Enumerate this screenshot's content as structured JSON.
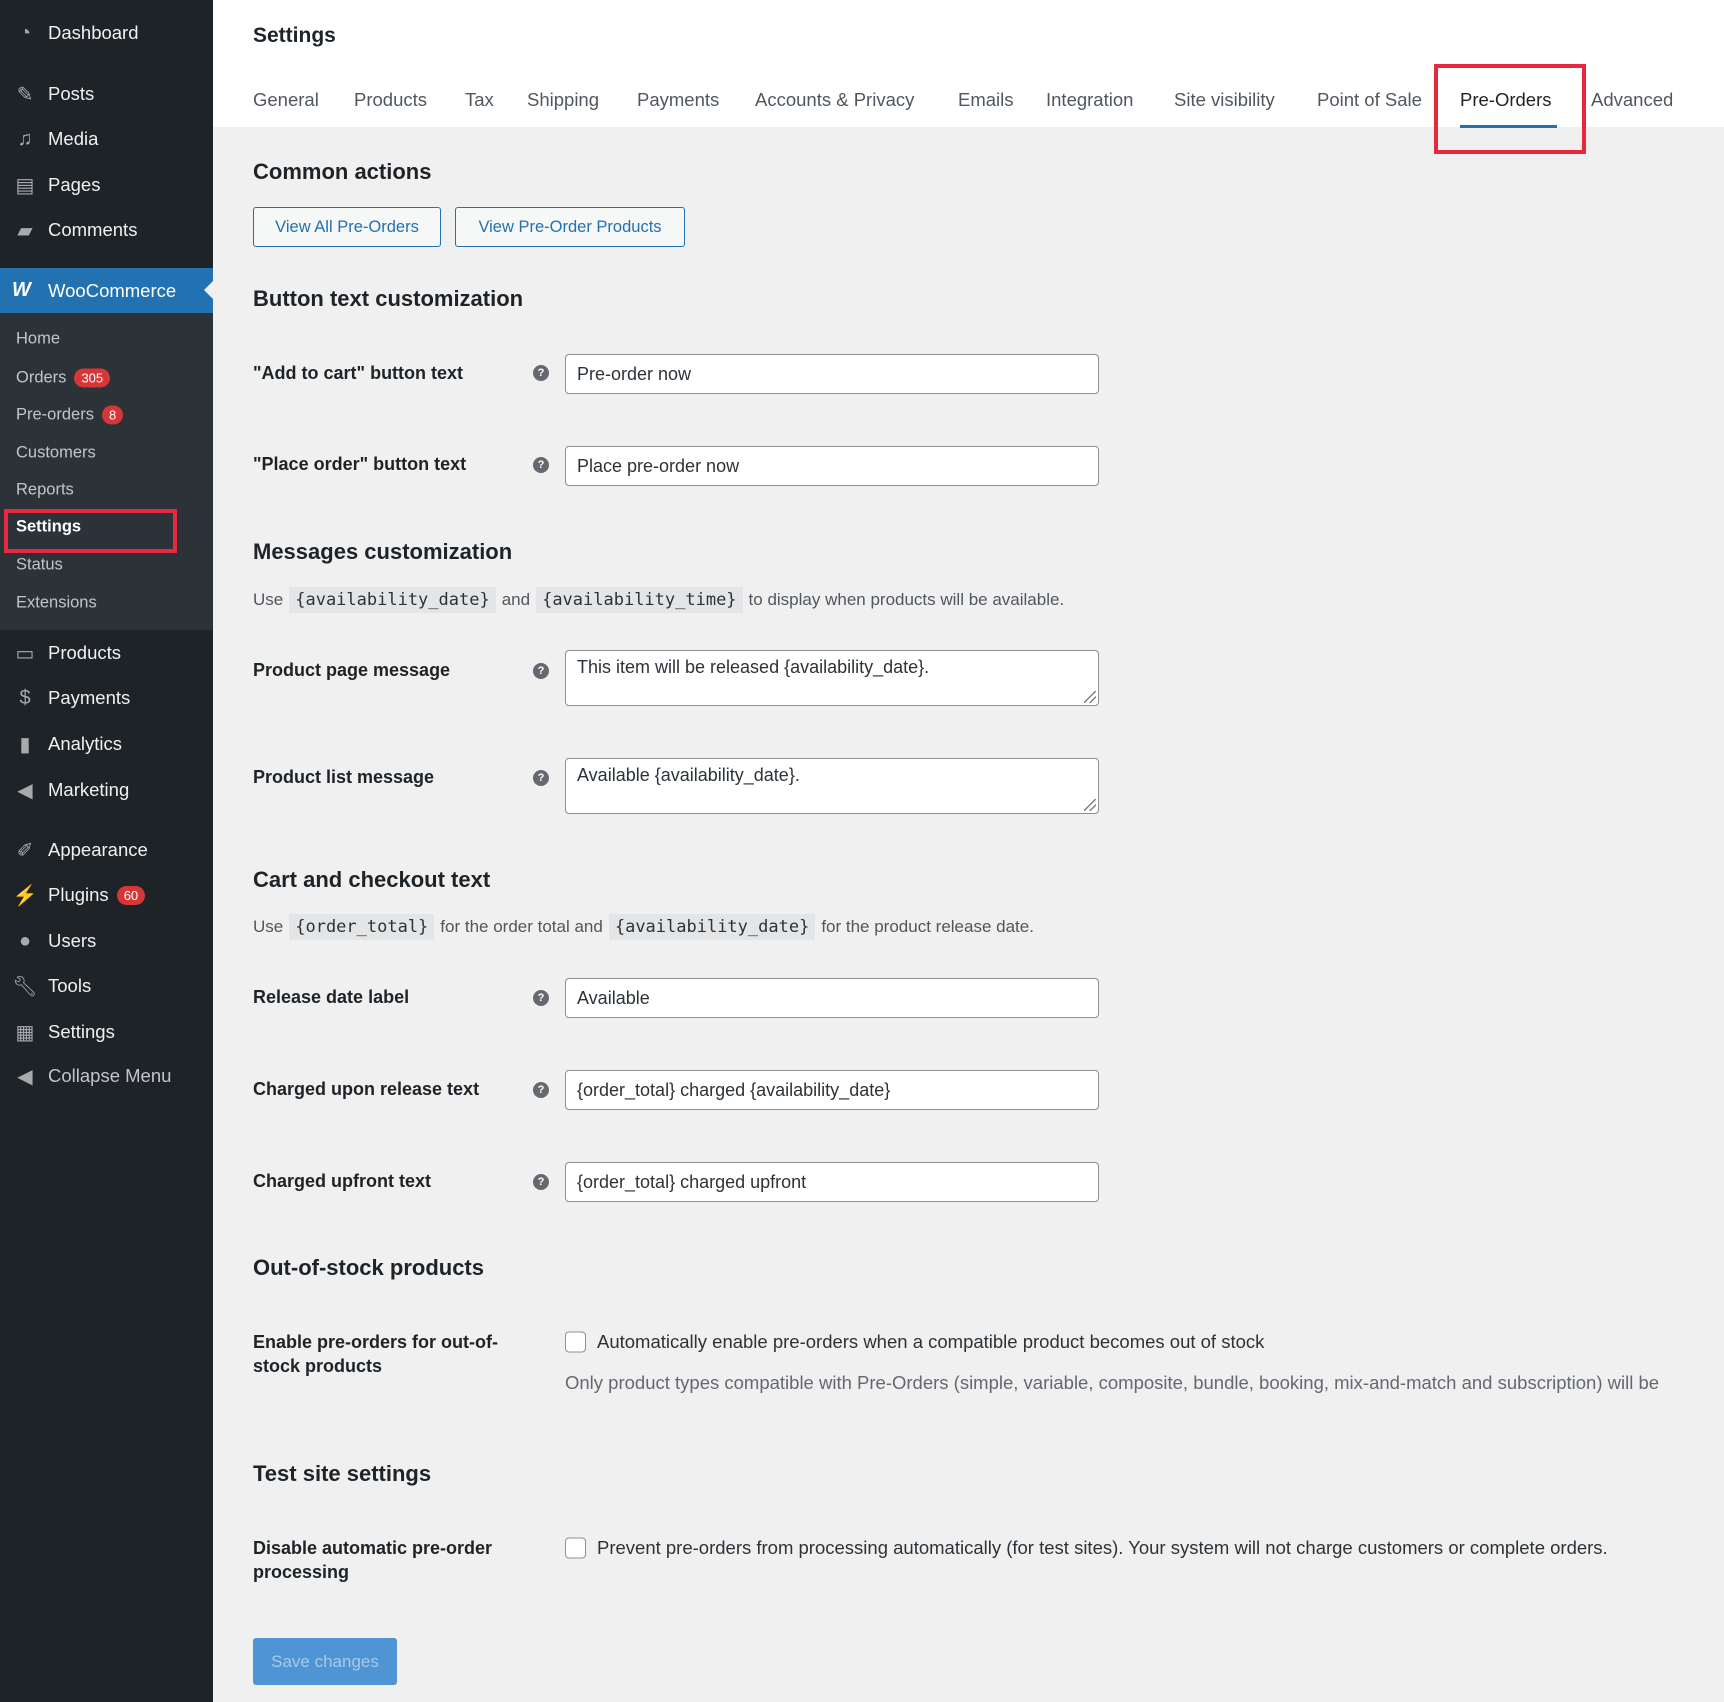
{
  "sidebar": {
    "top": [
      {
        "label": "Dashboard",
        "icon": "dashboard-icon"
      },
      {
        "label": "Posts",
        "icon": "pin-icon"
      },
      {
        "label": "Media",
        "icon": "media-icon"
      },
      {
        "label": "Pages",
        "icon": "pages-icon"
      },
      {
        "label": "Comments",
        "icon": "comment-icon"
      }
    ],
    "woocommerce": "WooCommerce",
    "submenu": [
      {
        "label": "Home"
      },
      {
        "label": "Orders",
        "badge": "305"
      },
      {
        "label": "Pre-orders",
        "badge": "8"
      },
      {
        "label": "Customers"
      },
      {
        "label": "Reports"
      },
      {
        "label": "Settings"
      },
      {
        "label": "Status"
      },
      {
        "label": "Extensions"
      }
    ],
    "bottom": [
      {
        "label": "Products"
      },
      {
        "label": "Payments"
      },
      {
        "label": "Analytics"
      },
      {
        "label": "Marketing"
      },
      {
        "label": "Appearance"
      },
      {
        "label": "Plugins",
        "badge": "60"
      },
      {
        "label": "Users"
      },
      {
        "label": "Tools"
      },
      {
        "label": "Settings"
      },
      {
        "label": "Collapse Menu"
      }
    ]
  },
  "header": {
    "title": "Settings",
    "tabs": [
      "General",
      "Products",
      "Tax",
      "Shipping",
      "Payments",
      "Accounts & Privacy",
      "Emails",
      "Integration",
      "Site visibility",
      "Point of Sale",
      "Pre-Orders",
      "Advanced"
    ],
    "active_tab": "Pre-Orders"
  },
  "common": {
    "heading": "Common actions",
    "btn1": "View All Pre-Orders",
    "btn2": "View Pre-Order Products"
  },
  "button_text": {
    "heading": "Button text customization",
    "add_label": "\"Add to cart\" button text",
    "add_value": "Pre-order now",
    "place_label": "\"Place order\" button text",
    "place_value": "Place pre-order now"
  },
  "messages": {
    "heading": "Messages customization",
    "use": "Use",
    "code1": "{availability_date}",
    "and": "and",
    "code2": "{availability_time}",
    "tail": "to display when products will be available.",
    "page_label": "Product page message",
    "page_value": "This item will be released {availability_date}.",
    "list_label": "Product list message",
    "list_value": "Available {availability_date}."
  },
  "cart": {
    "heading": "Cart and checkout text",
    "use": "Use",
    "code1": "{order_total}",
    "mid": "for the order total and",
    "code2": "{availability_date}",
    "tail": "for the product release date.",
    "release_label": "Release date label",
    "release_value": "Available",
    "upon_label": "Charged upon release text",
    "upon_value": "{order_total} charged {availability_date}",
    "upfront_label": "Charged upfront text",
    "upfront_value": "{order_total} charged upfront"
  },
  "oos": {
    "heading": "Out-of-stock products",
    "label1": "Enable pre-orders for out-of-",
    "label2": "stock products",
    "checkbox": "Automatically enable pre-orders when a compatible product becomes out of stock",
    "checked": false,
    "note": "Only product types compatible with Pre-Orders (simple, variable, composite, bundle, booking, mix-and-match and subscription) will be"
  },
  "test": {
    "heading": "Test site settings",
    "label1": "Disable automatic pre-order",
    "label2": "processing",
    "checkbox": "Prevent pre-orders from processing automatically (for test sites). Your system will not charge customers or complete orders.",
    "checked": false
  },
  "save": "Save changes"
}
